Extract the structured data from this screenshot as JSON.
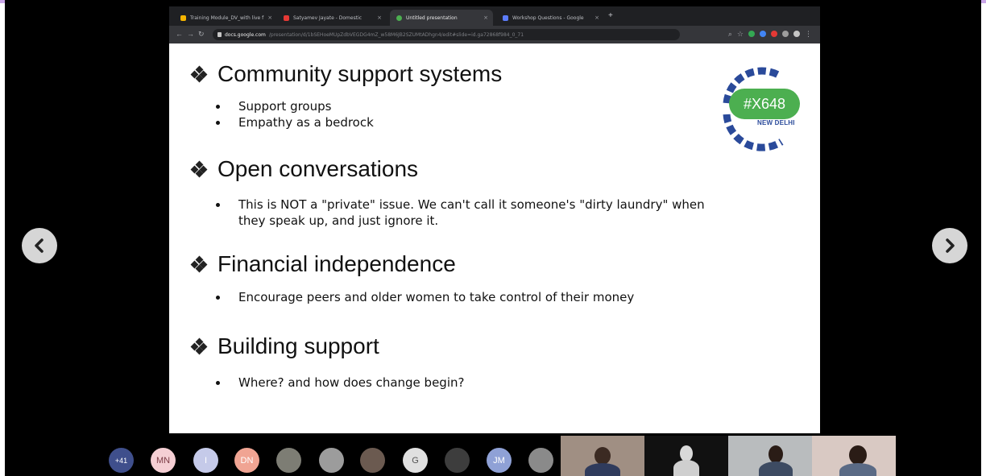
{
  "browser": {
    "tabs": [
      {
        "title": "Training Module_DV_with live f",
        "favicon_color": "#f4b400"
      },
      {
        "title": "Satyamev Jayate - Domestic",
        "favicon_color": "#e53935"
      },
      {
        "title": "Untitled presentation",
        "favicon_color": "#4caf50"
      },
      {
        "title": "Workshop Questions - Google",
        "favicon_color": "#5c7cfa"
      }
    ],
    "tab_close_glyph": "×",
    "new_tab_glyph": "+",
    "url_host": "docs.google.com",
    "url_path": "/presentation/d/1bSEHoeMUpZdbVEGDG4mZ_w58M6JB2SZUMtADhgn4/edit#slide=id.ga72868f984_0_71"
  },
  "slide": {
    "sections": [
      {
        "heading": "Community support systems",
        "bullets": [
          "Support groups",
          "Empathy as a bedrock"
        ]
      },
      {
        "heading": "Open conversations",
        "bullets": [
          "This is NOT a \"private\" issue. We can't call it someone's \"dirty laundry\" when they speak up, and just ignore it."
        ]
      },
      {
        "heading": "Financial independence",
        "bullets": [
          "Encourage peers and older women to take control of their money"
        ]
      },
      {
        "heading": "Building support",
        "bullets": [
          "Where? and how does change begin?"
        ]
      }
    ],
    "logo": {
      "badge_text": "#X648",
      "sub_text": "NEW DELHI",
      "ring_color": "#2a4a9a",
      "badge_color": "#4caf50"
    }
  },
  "participants": {
    "overflow_label": "+41",
    "avatars": [
      {
        "initials": "MN",
        "color": "#f5cfd4",
        "text_color": "#7b3b45"
      },
      {
        "initials": "I",
        "color": "#c5cae9",
        "text_color": "#ffffff"
      },
      {
        "initials": "DN",
        "color": "#f0a493",
        "text_color": "#ffffff"
      },
      {
        "initials": "",
        "color": "#7d7d74",
        "text_color": "#ffffff"
      },
      {
        "initials": "",
        "color": "#9c9c9c",
        "text_color": "#ffffff"
      },
      {
        "initials": "",
        "color": "#6b5a50",
        "text_color": "#ffffff"
      },
      {
        "initials": "G",
        "color": "#e0e0e0",
        "text_color": "#555555"
      },
      {
        "initials": "",
        "color": "#3d3d3d",
        "text_color": "#ffffff"
      },
      {
        "initials": "JM",
        "color": "#8fa1d6",
        "text_color": "#ffffff"
      },
      {
        "initials": "",
        "color": "#8a8a8a",
        "text_color": "#ffffff"
      }
    ]
  },
  "colors": {
    "accent_bar": "#c9a6e8",
    "overflow_badge": "#3f4f8c"
  }
}
